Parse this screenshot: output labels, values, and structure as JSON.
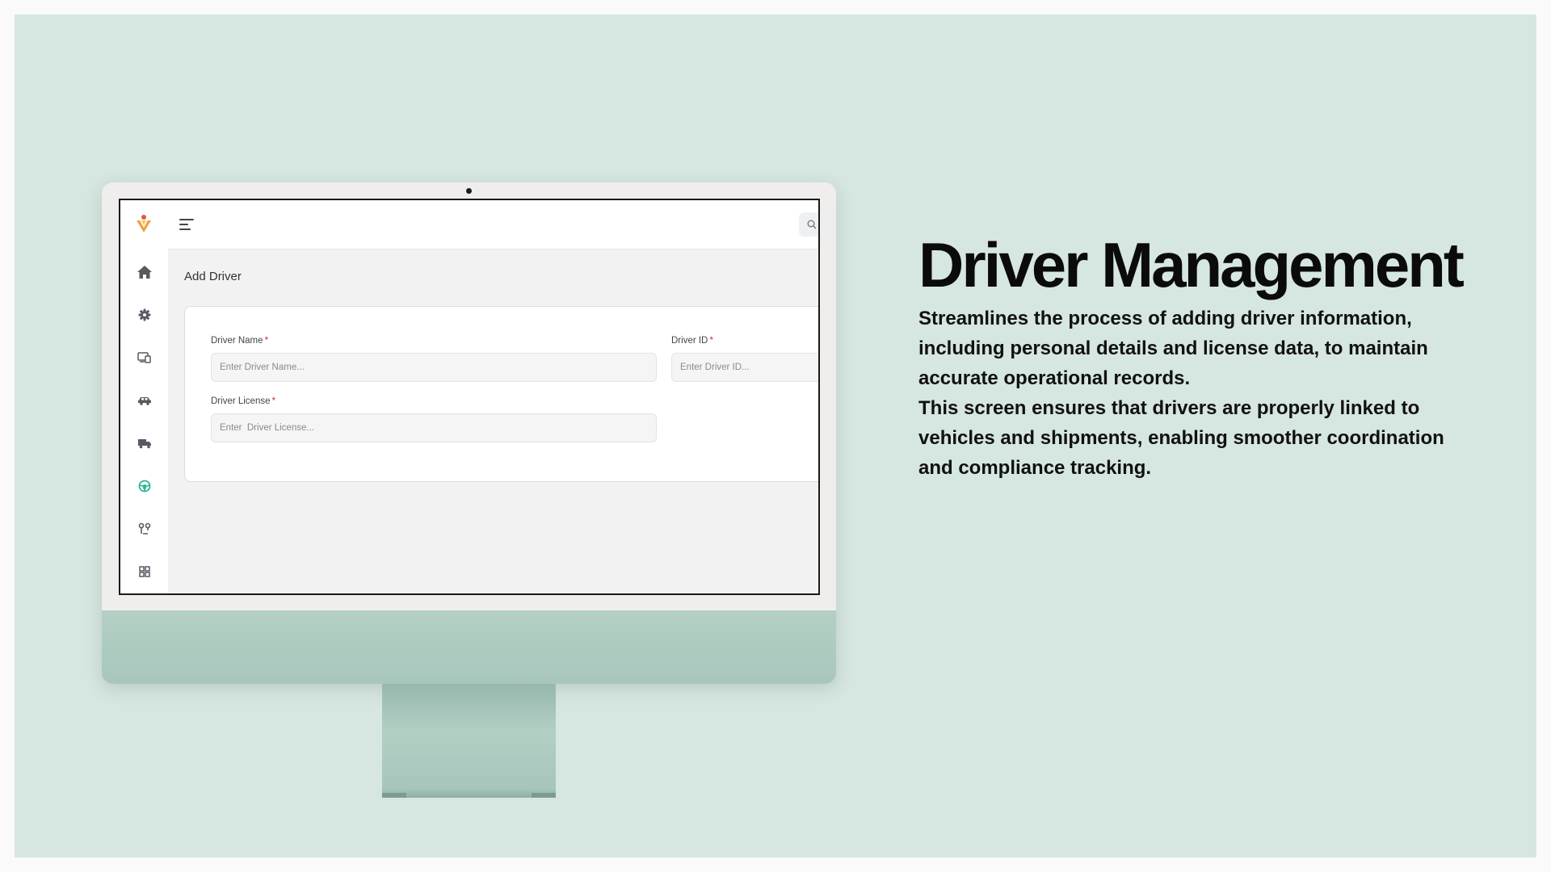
{
  "colors": {
    "background": "#d6e6e0",
    "accent_teal": "#2bb39c",
    "logo_orange": "#f0a23a",
    "required_red": "#d32f2f"
  },
  "heading": "Driver Management",
  "description": "Streamlines the process of adding driver information, including personal details and license data, to maintain accurate operational records.\n This screen ensures that drivers are properly linked to vehicles and shipments, enabling smoother coordination and compliance tracking.",
  "app": {
    "logo_icon": "v-logo-icon",
    "menu_icon": "hamburger-menu-icon",
    "search_icon": "search-icon",
    "sidebar": [
      {
        "icon": "home-icon",
        "active": false
      },
      {
        "icon": "gear-icon",
        "active": false
      },
      {
        "icon": "devices-icon",
        "active": false
      },
      {
        "icon": "car-icon",
        "active": false
      },
      {
        "icon": "truck-icon",
        "active": false
      },
      {
        "icon": "steering-wheel-icon",
        "active": true
      },
      {
        "icon": "route-icon",
        "active": false
      },
      {
        "icon": "grid-icon",
        "active": false
      }
    ],
    "page_title": "Add Driver",
    "form": {
      "driver_name": {
        "label": "Driver Name",
        "required_mark": "*",
        "placeholder": "Enter Driver Name...",
        "value": ""
      },
      "driver_id": {
        "label": "Driver ID",
        "required_mark": "*",
        "placeholder": "Enter Driver ID...",
        "value": ""
      },
      "driver_license": {
        "label": "Driver License",
        "required_mark": "*",
        "placeholder": "Enter  Driver License...",
        "value": ""
      }
    }
  }
}
